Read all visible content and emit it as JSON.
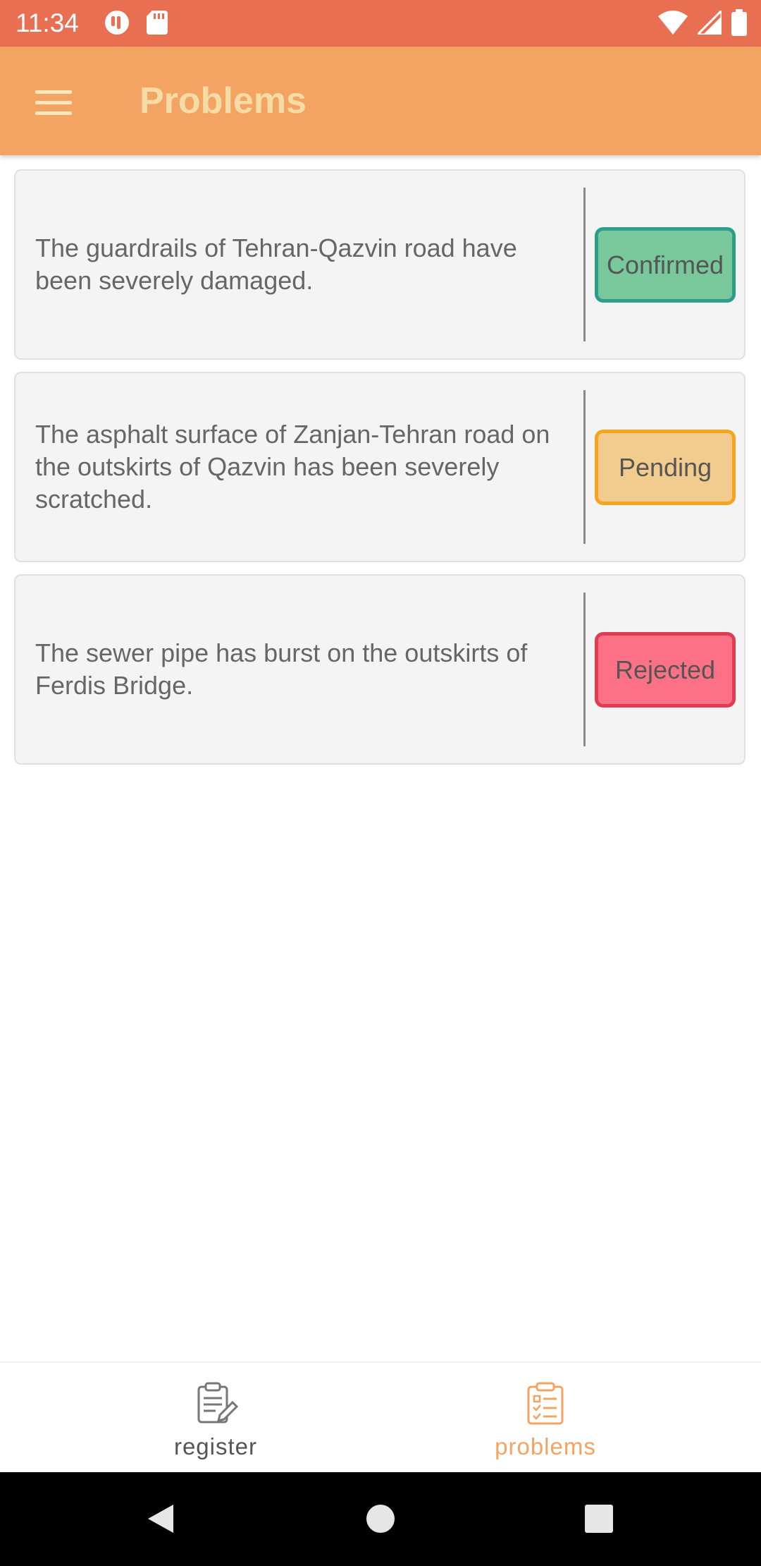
{
  "status_bar": {
    "time": "11:34"
  },
  "app_bar": {
    "title": "Problems",
    "menu_icon": "hamburger-menu-icon"
  },
  "problems": [
    {
      "description": "The guardrails of Tehran-Qazvin road have been severely damaged.",
      "status": "Confirmed",
      "status_color": "#78c89c",
      "status_border": "#2e9d8a"
    },
    {
      "description": "The asphalt surface of Zanjan-Tehran road on the outskirts of Qazvin has been severely scratched.",
      "status": "Pending",
      "status_color": "#f2cc8e",
      "status_border": "#f7a41d"
    },
    {
      "description": "The sewer pipe has burst on the outskirts of Ferdis Bridge.",
      "status": "Rejected",
      "status_color": "#fd7187",
      "status_border": "#e03d52"
    }
  ],
  "bottom_nav": {
    "register_label": "register",
    "problems_label": "problems",
    "active": "problems",
    "active_color": "#f3a462",
    "inactive_color": "#555555"
  },
  "colors": {
    "status_bar": "#e96f52",
    "app_bar": "#f3a462",
    "title": "#f5dca6"
  }
}
